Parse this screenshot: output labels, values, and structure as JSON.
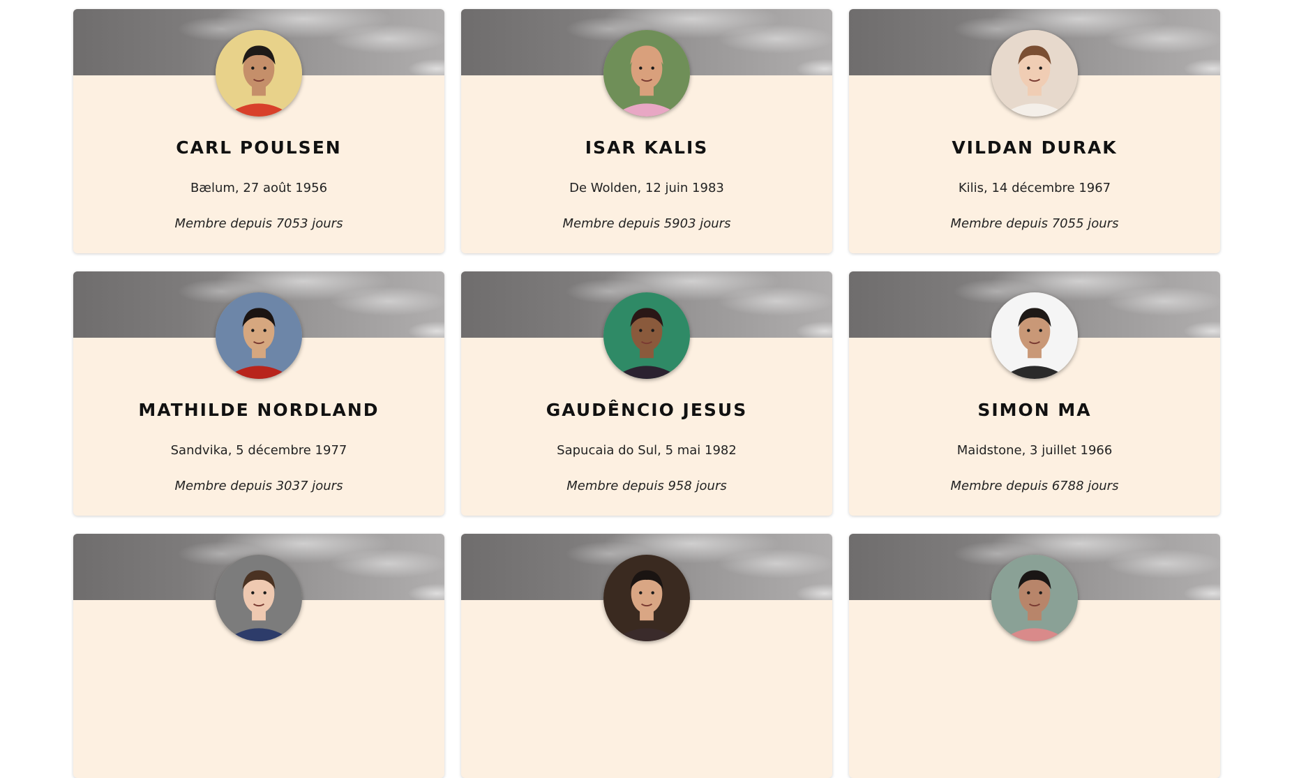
{
  "members": [
    {
      "name": "CARL POULSEN",
      "birth": "Bælum, 27 août 1956",
      "member_since": "Membre depuis 7053 jours",
      "photo": {
        "bg": "#e8d28a",
        "skin": "#c58f6a",
        "hair": "#1e1a18",
        "shirt": "#d8402a"
      }
    },
    {
      "name": "ISAR KALIS",
      "birth": "De Wolden, 12 juin 1983",
      "member_since": "Membre depuis 5903 jours",
      "photo": {
        "bg": "#6f8f58",
        "skin": "#d9a07c",
        "hair": "#d9a07c",
        "shirt": "#e8a7c4"
      }
    },
    {
      "name": "VILDAN DURAK",
      "birth": "Kilis, 14 décembre 1967",
      "member_since": "Membre depuis 7055 jours",
      "photo": {
        "bg": "#e7d9cc",
        "skin": "#f0cdb4",
        "hair": "#7a4e32",
        "shirt": "#f4efe9"
      }
    },
    {
      "name": "MATHILDE NORDLAND",
      "birth": "Sandvika, 5 décembre 1977",
      "member_since": "Membre depuis 3037 jours",
      "photo": {
        "bg": "#6d86a8",
        "skin": "#d6a77f",
        "hair": "#1b1412",
        "shirt": "#b8241c"
      }
    },
    {
      "name": "GAUDÊNCIO JESUS",
      "birth": "Sapucaia do Sul, 5 mai 1982",
      "member_since": "Membre depuis 958 jours",
      "photo": {
        "bg": "#2f8a66",
        "skin": "#8a5a3c",
        "hair": "#2a1716",
        "shirt": "#2b2230"
      }
    },
    {
      "name": "SIMON MA",
      "birth": "Maidstone, 3 juillet 1966",
      "member_since": "Membre depuis 6788 jours",
      "photo": {
        "bg": "#f5f5f5",
        "skin": "#c99877",
        "hair": "#1e1916",
        "shirt": "#2a2a2a"
      }
    },
    {
      "name": "",
      "birth": "",
      "member_since": "",
      "photo": {
        "bg": "#7c7c7c",
        "skin": "#efc9b1",
        "hair": "#4a3222",
        "shirt": "#2d3c6a"
      }
    },
    {
      "name": "",
      "birth": "",
      "member_since": "",
      "photo": {
        "bg": "#3a2a20",
        "skin": "#d9a684",
        "hair": "#1a1412",
        "shirt": "#3a2b2b"
      }
    },
    {
      "name": "",
      "birth": "",
      "member_since": "",
      "photo": {
        "bg": "#8aa196",
        "skin": "#b8856a",
        "hair": "#1a1615",
        "shirt": "#d98a8a"
      }
    }
  ]
}
